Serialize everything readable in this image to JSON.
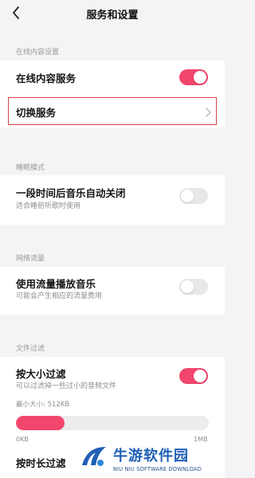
{
  "header": {
    "title": "服务和设置"
  },
  "online": {
    "section_label": "在线内容设置",
    "service_label": "在线内容服务",
    "service_enabled": true,
    "switch_label": "切换服务"
  },
  "sleep": {
    "section_label": "睡眠模式",
    "title": "一段时间后音乐自动关闭",
    "subtitle": "适合睡前听歌时使用",
    "enabled": false
  },
  "network": {
    "section_label": "网络流量",
    "title": "使用流量播放音乐",
    "subtitle": "可能会产生相应的流量费用",
    "enabled": false
  },
  "file_filter": {
    "section_label": "文件过滤",
    "size_title": "按大小过滤",
    "size_subtitle": "可以过滤掉一些过小的音频文件",
    "size_enabled": true,
    "min_size_label": "最小大小: 512KB",
    "slider_min": "0KB",
    "slider_max": "1MB",
    "slider_fraction": 0.25,
    "duration_title": "按时长过滤"
  },
  "watermark": {
    "main": "牛游软件园",
    "sub": "NIU NIU SOFTWARE DOWNLOAD"
  },
  "colors": {
    "accent": "#f2466d",
    "highlight": "#d9414b",
    "watermark": "#1f5fb5"
  }
}
